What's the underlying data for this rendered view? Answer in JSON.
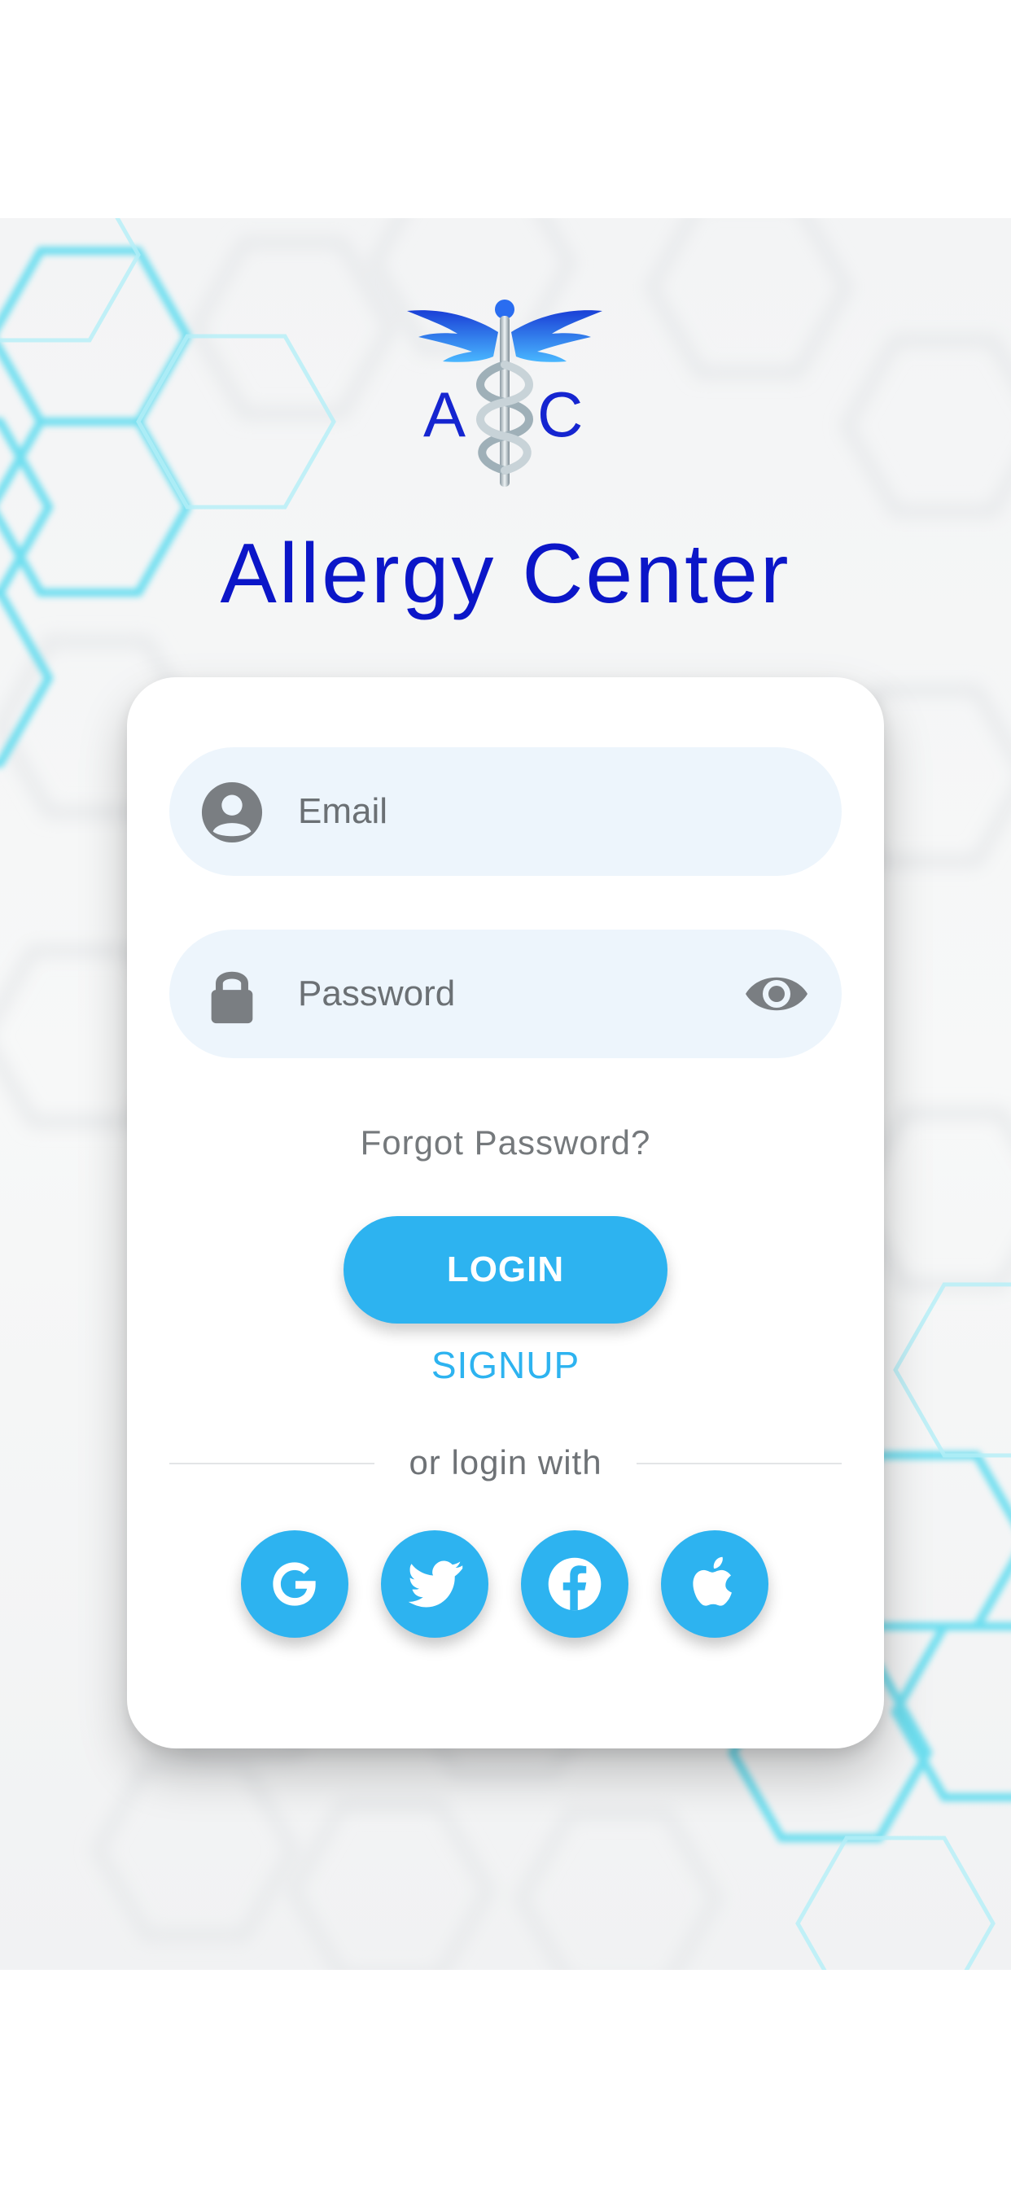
{
  "brand": {
    "logo_letters": [
      "A",
      "C"
    ],
    "title": "Allergy Center"
  },
  "login_form": {
    "email": {
      "placeholder": "Email",
      "value": "",
      "icon": "user-circle-icon"
    },
    "password": {
      "placeholder": "Password",
      "value": "",
      "icon": "lock-icon",
      "toggle_icon": "eye-icon"
    },
    "forgot_password_label": "Forgot Password?",
    "login_label": "LOGIN",
    "signup_label": "SIGNUP",
    "divider_label": "or login with"
  },
  "social_login": [
    {
      "name": "google",
      "icon": "google-icon"
    },
    {
      "name": "twitter",
      "icon": "twitter-icon"
    },
    {
      "name": "facebook",
      "icon": "facebook-icon"
    },
    {
      "name": "apple",
      "icon": "apple-icon"
    }
  ],
  "colors": {
    "accent": "#2db3f0",
    "brand_title": "#0b16c8",
    "field_background": "#edf5fc",
    "icon_grey": "#7a7e82",
    "hexagon_accent": "#5fdcef"
  }
}
